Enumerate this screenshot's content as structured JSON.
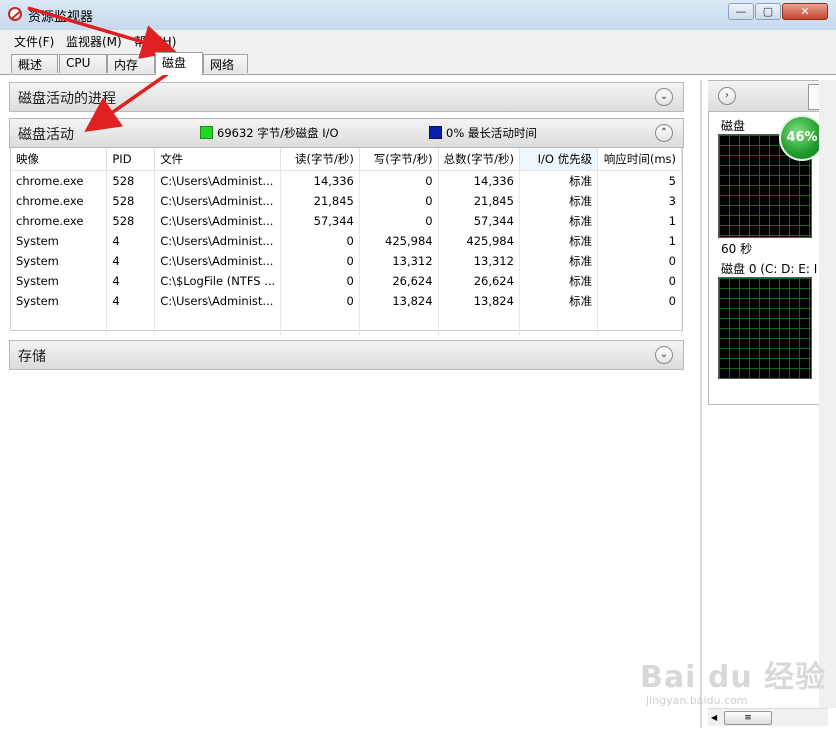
{
  "window": {
    "title": "资源监视器",
    "min_label": "—",
    "max_label": "▢",
    "close_label": "✕"
  },
  "menu": [
    "文件(F)",
    "监视器(M)",
    "帮助(H)"
  ],
  "tabs": [
    "概述",
    "CPU",
    "内存",
    "磁盘",
    "网络"
  ],
  "active_tab": "磁盘",
  "sections": {
    "processes": {
      "title": "磁盘活动的进程",
      "toggle": "⌄"
    },
    "activity": {
      "title": "磁盘活动",
      "toggle": "⌃",
      "legend_io": "69632 字节/秒磁盘 I/O",
      "legend_active": "0% 最长活动时间",
      "legend_io_color": "#22d922",
      "legend_active_color": "#0b1ea8"
    },
    "storage": {
      "title": "存储",
      "toggle": "⌄"
    }
  },
  "table": {
    "columns": [
      "映像",
      "PID",
      "文件",
      "读(字节/秒)",
      "写(字节/秒)",
      "总数(字节/秒)",
      "I/O 优先级",
      "响应时间(ms)"
    ],
    "rows": [
      [
        "chrome.exe",
        "528",
        "C:\\Users\\Administ...",
        "14,336",
        "0",
        "14,336",
        "标准",
        "5"
      ],
      [
        "chrome.exe",
        "528",
        "C:\\Users\\Administ...",
        "21,845",
        "0",
        "21,845",
        "标准",
        "3"
      ],
      [
        "chrome.exe",
        "528",
        "C:\\Users\\Administ...",
        "57,344",
        "0",
        "57,344",
        "标准",
        "1"
      ],
      [
        "System",
        "4",
        "C:\\Users\\Administ...",
        "0",
        "425,984",
        "425,984",
        "标准",
        "1"
      ],
      [
        "System",
        "4",
        "C:\\Users\\Administ...",
        "0",
        "13,312",
        "13,312",
        "标准",
        "0"
      ],
      [
        "System",
        "4",
        "C:\\$LogFile (NTFS ...",
        "0",
        "26,624",
        "26,624",
        "标准",
        "0"
      ],
      [
        "System",
        "4",
        "C:\\Users\\Administ...",
        "0",
        "13,824",
        "13,824",
        "标准",
        "0"
      ]
    ]
  },
  "right_panel": {
    "nav_label": "›",
    "disk_label": "磁盘",
    "time_label": "60 秒",
    "disk0_label": "磁盘 0 (C: D: E: I",
    "badge": "46%",
    "scroll_thumb": "≡"
  },
  "watermark": {
    "main": "Bai du 经验",
    "sub": "jingyan.baidu.com"
  },
  "arrow_color": "#e02020"
}
